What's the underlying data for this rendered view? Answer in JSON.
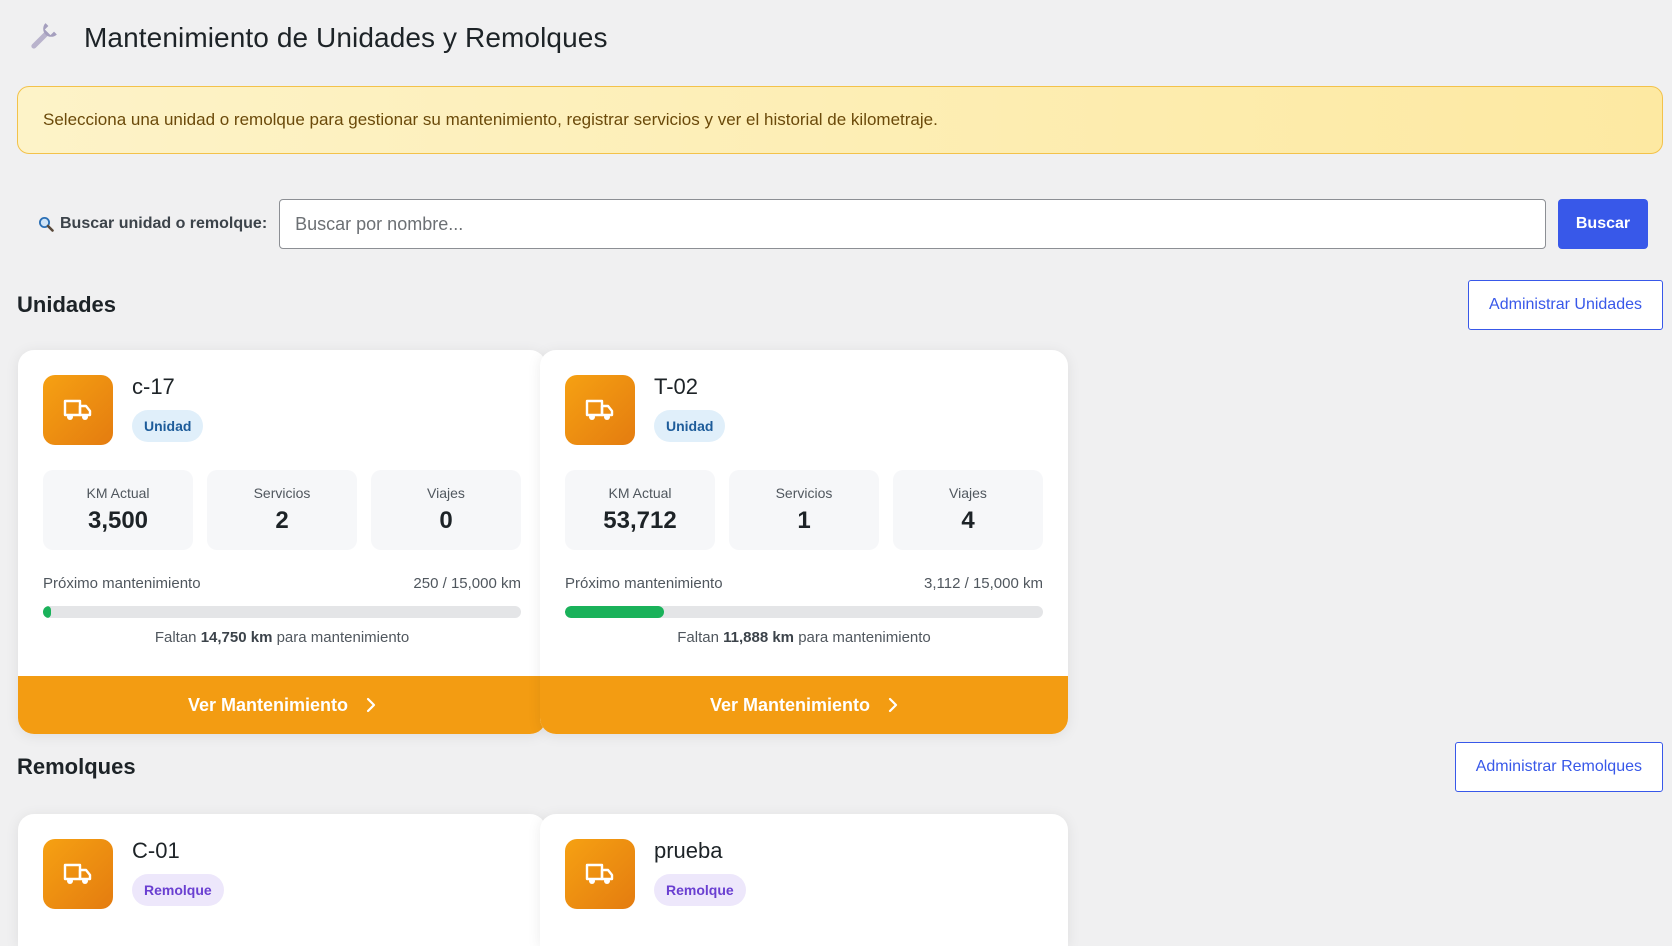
{
  "page": {
    "title": "Mantenimiento de Unidades y Remolques",
    "notice": "Selecciona una unidad o remolque para gestionar su mantenimiento, registrar servicios y ver el historial de kilometraje."
  },
  "search": {
    "label": "Buscar unidad o remolque:",
    "placeholder": "Buscar por nombre...",
    "button": "Buscar"
  },
  "unidades": {
    "title": "Unidades",
    "admin_button": "Administrar Unidades",
    "cards": [
      {
        "name": "c-17",
        "type": "Unidad",
        "stats": [
          {
            "label": "KM Actual",
            "value": "3,500"
          },
          {
            "label": "Servicios",
            "value": "2"
          },
          {
            "label": "Viajes",
            "value": "0"
          }
        ],
        "progress_label": "Próximo mantenimiento",
        "progress_value": "250 / 15,000 km",
        "progress_fraction": 0.0167,
        "remaining_prefix": "Faltan",
        "remaining_km": "14,750 km",
        "remaining_suffix": "para mantenimiento",
        "action": "Ver Mantenimiento"
      },
      {
        "name": "T-02",
        "type": "Unidad",
        "stats": [
          {
            "label": "KM Actual",
            "value": "53,712"
          },
          {
            "label": "Servicios",
            "value": "1"
          },
          {
            "label": "Viajes",
            "value": "4"
          }
        ],
        "progress_label": "Próximo mantenimiento",
        "progress_value": "3,112 / 15,000 km",
        "progress_fraction": 0.2075,
        "remaining_prefix": "Faltan",
        "remaining_km": "11,888 km",
        "remaining_suffix": "para mantenimiento",
        "action": "Ver Mantenimiento"
      }
    ]
  },
  "remolques": {
    "title": "Remolques",
    "admin_button": "Administrar Remolques",
    "cards": [
      {
        "name": "C-01",
        "type": "Remolque"
      },
      {
        "name": "prueba",
        "type": "Remolque"
      }
    ]
  },
  "colors": {
    "accent": "#3858e9",
    "action": "#f39c12",
    "progress": "#1ab25a",
    "notice_border": "#f3c24a"
  },
  "icons": {
    "header": "wrench-icon",
    "search": "magnifier-icon",
    "vehicle": "truck-icon",
    "action": "chevron-right-icon"
  }
}
